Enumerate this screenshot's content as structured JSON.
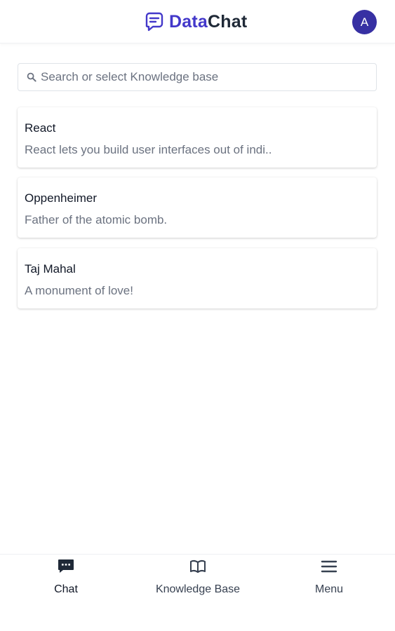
{
  "header": {
    "logo_part1": "Data",
    "logo_part2": "Chat",
    "avatar_initial": "A",
    "brand_color": "#4338ca",
    "avatar_color": "#3730a3"
  },
  "search": {
    "placeholder": "Search or select Knowledge base"
  },
  "knowledge_bases": [
    {
      "title": "React",
      "description": "React lets you build user interfaces out of indi.."
    },
    {
      "title": "Oppenheimer",
      "description": "Father of the atomic bomb."
    },
    {
      "title": "Taj Mahal",
      "description": "A monument of love!"
    }
  ],
  "bottom_nav": {
    "items": [
      {
        "label": "Chat",
        "icon": "chat-icon",
        "active": true
      },
      {
        "label": "Knowledge Base",
        "icon": "book-icon",
        "active": false
      },
      {
        "label": "Menu",
        "icon": "menu-icon",
        "active": false
      }
    ]
  }
}
